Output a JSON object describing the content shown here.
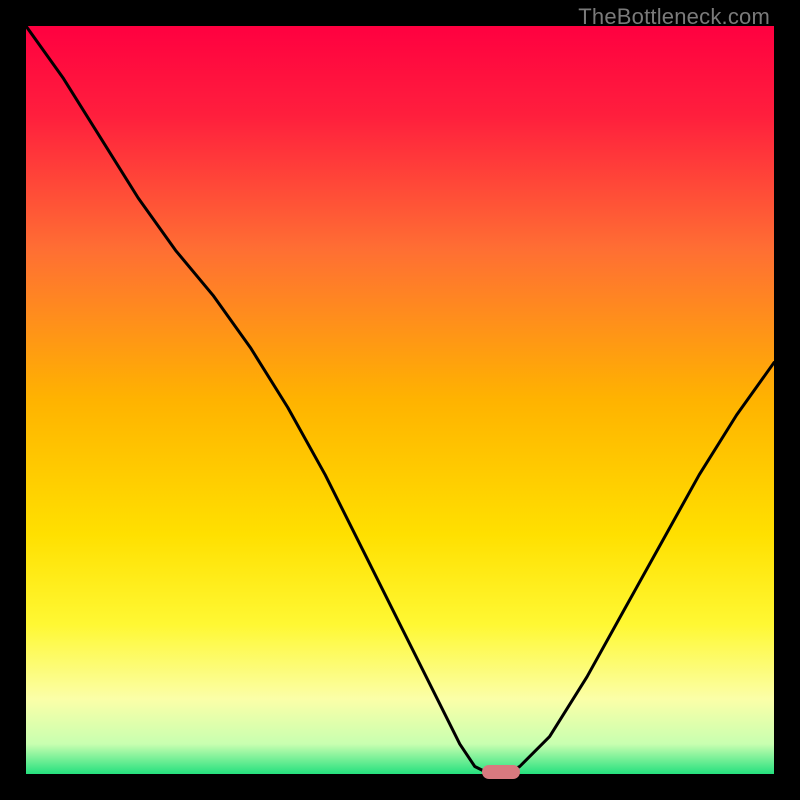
{
  "watermark": "TheBottleneck.com",
  "colors": {
    "stops": [
      {
        "offset": "0%",
        "color": "#ff0040"
      },
      {
        "offset": "12%",
        "color": "#ff1f3d"
      },
      {
        "offset": "30%",
        "color": "#ff6f33"
      },
      {
        "offset": "50%",
        "color": "#ffb300"
      },
      {
        "offset": "68%",
        "color": "#ffe000"
      },
      {
        "offset": "80%",
        "color": "#fff833"
      },
      {
        "offset": "90%",
        "color": "#fbffa8"
      },
      {
        "offset": "96%",
        "color": "#c8ffb0"
      },
      {
        "offset": "100%",
        "color": "#25e07e"
      }
    ],
    "curve": "#000000",
    "marker": "#d8797f",
    "frame": "#000000"
  },
  "chart_data": {
    "type": "line",
    "title": "",
    "xlabel": "",
    "ylabel": "",
    "xlim": [
      0,
      100
    ],
    "ylim": [
      0,
      100
    ],
    "x": [
      0,
      5,
      10,
      15,
      20,
      25,
      30,
      35,
      40,
      45,
      50,
      55,
      58,
      60,
      62,
      64,
      66,
      70,
      75,
      80,
      85,
      90,
      95,
      100
    ],
    "values": [
      100,
      93,
      85,
      77,
      70,
      64,
      57,
      49,
      40,
      30,
      20,
      10,
      4,
      1,
      0,
      0,
      1,
      5,
      13,
      22,
      31,
      40,
      48,
      55
    ],
    "optimal_x": [
      61,
      66
    ],
    "note": "V-shaped bottleneck curve; y is percentage bottleneck (0 = optimal). Values estimated from pixel positions on a 0–100 vertical scale."
  }
}
